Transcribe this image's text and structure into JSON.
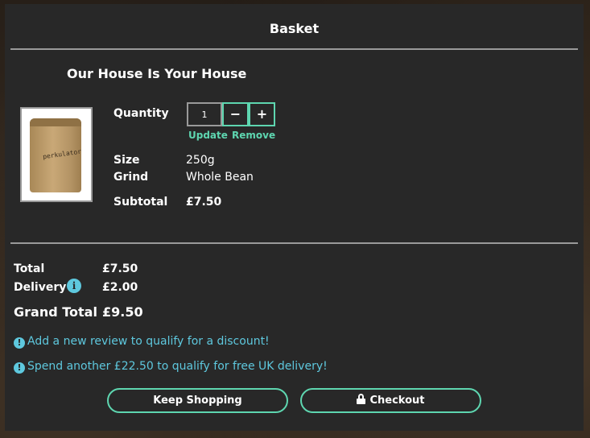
{
  "header": {
    "title": "Basket"
  },
  "item": {
    "name": "Our House Is Your House",
    "image": {
      "icon": "coffee-bag-image",
      "brand_text": "perkulator"
    },
    "quantity_label": "Quantity",
    "quantity_value": "1",
    "decrement_label": "−",
    "increment_label": "+",
    "update_label": "Update",
    "remove_label": "Remove",
    "size_label": "Size",
    "size_value": "250g",
    "grind_label": "Grind",
    "grind_value": "Whole Bean",
    "subtotal_label": "Subtotal",
    "subtotal_value": "£7.50"
  },
  "summary": {
    "total_label": "Total",
    "total_value": "£7.50",
    "delivery_label": "Delivery",
    "delivery_info_icon": "i",
    "delivery_value": "£2.00",
    "grand_total_label": "Grand Total",
    "grand_total_value": "£9.50"
  },
  "notices": [
    {
      "icon": "!",
      "text": "Add a new review to qualify for a discount!"
    },
    {
      "icon": "!",
      "text": "Spend another £22.50 to qualify for free UK delivery!"
    }
  ],
  "actions": {
    "keep_shopping_label": "Keep Shopping",
    "checkout_label": "Checkout"
  },
  "colors": {
    "accent": "#5ed6b0",
    "info": "#5ec8de",
    "panel": "#282828"
  }
}
